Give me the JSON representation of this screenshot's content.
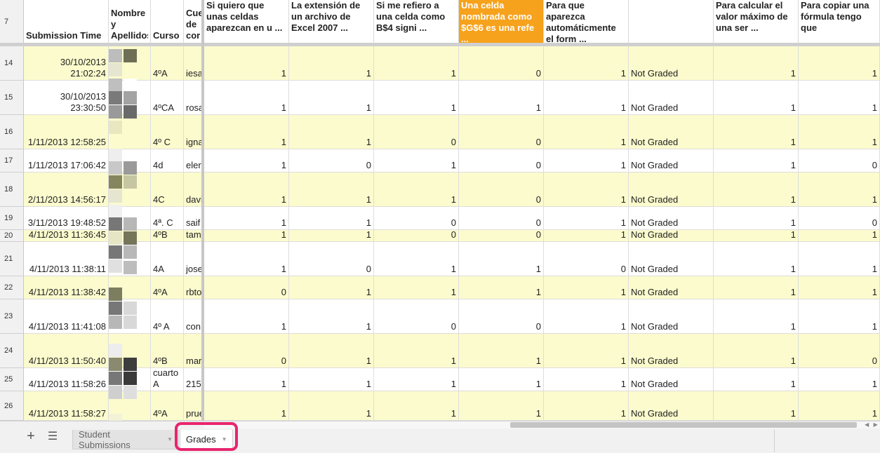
{
  "header": {
    "row_number": "7",
    "columns": [
      "Submission Time",
      "Nombre y Apellidos",
      "Curso",
      "Cue de cor",
      "Si quiero que unas celdas aparezcan en u ...",
      "La extensión de un archivo de Excel 2007 ...",
      "Si me refiero a una celda como B$4 signi ...",
      "Una celda nombrada como $G$6 es una refe ...",
      "Para que aparezca automáticmente el form ...",
      "",
      "Para calcular el valor máximo de una ser ...",
      "Para copiar una fórmula tengo que"
    ]
  },
  "rows": [
    {
      "num": "14",
      "time": "30/10/2013 21:02:24",
      "curso": "4ºA",
      "cue": "iesa",
      "q1": "1",
      "q2": "1",
      "q3": "1",
      "q4": "0",
      "q5": "1",
      "status": "Not Graded",
      "q6": "1",
      "q7": "1"
    },
    {
      "num": "15",
      "time": "30/10/2013 23:30:50",
      "curso": "4ºCA",
      "cue": "rosa",
      "q1": "1",
      "q2": "1",
      "q3": "1",
      "q4": "1",
      "q5": "1",
      "status": "Not Graded",
      "q6": "1",
      "q7": "1"
    },
    {
      "num": "16",
      "time": "1/11/2013 12:58:25",
      "curso": "4º C",
      "cue": "igna",
      "q1": "1",
      "q2": "1",
      "q3": "0",
      "q4": "0",
      "q5": "1",
      "status": "Not Graded",
      "q6": "1",
      "q7": "1"
    },
    {
      "num": "17",
      "time": "1/11/2013 17:06:42",
      "curso": "4d",
      "cue": "eler",
      "q1": "1",
      "q2": "0",
      "q3": "1",
      "q4": "0",
      "q5": "1",
      "status": "Not Graded",
      "q6": "1",
      "q7": "0"
    },
    {
      "num": "18",
      "time": "2/11/2013 14:56:17",
      "curso": "4C",
      "cue": "davi",
      "q1": "1",
      "q2": "1",
      "q3": "1",
      "q4": "0",
      "q5": "1",
      "status": "Not Graded",
      "q6": "1",
      "q7": "1"
    },
    {
      "num": "19",
      "time": "3/11/2013 19:48:52",
      "curso": "4ª. C",
      "cue": "saif",
      "q1": "1",
      "q2": "1",
      "q3": "0",
      "q4": "0",
      "q5": "1",
      "status": "Not Graded",
      "q6": "1",
      "q7": "0"
    },
    {
      "num": "20",
      "time": "4/11/2013 11:36:45",
      "curso": "4ºB",
      "cue": "tam",
      "q1": "1",
      "q2": "1",
      "q3": "0",
      "q4": "0",
      "q5": "1",
      "status": "Not Graded",
      "q6": "1",
      "q7": "1"
    },
    {
      "num": "21",
      "time": "4/11/2013 11:38:11",
      "curso": "4A",
      "cue": "jose",
      "q1": "1",
      "q2": "0",
      "q3": "1",
      "q4": "1",
      "q5": "0",
      "status": "Not Graded",
      "q6": "1",
      "q7": "1"
    },
    {
      "num": "22",
      "time": "4/11/2013 11:38:42",
      "curso": "4ºA",
      "cue": "rbto",
      "q1": "0",
      "q2": "1",
      "q3": "1",
      "q4": "1",
      "q5": "1",
      "status": "Not Graded",
      "q6": "1",
      "q7": "1"
    },
    {
      "num": "23",
      "time": "4/11/2013 11:41:08",
      "curso": "4º A",
      "cue": "con",
      "q1": "1",
      "q2": "1",
      "q3": "0",
      "q4": "0",
      "q5": "1",
      "status": "Not Graded",
      "q6": "1",
      "q7": "1"
    },
    {
      "num": "24",
      "time": "4/11/2013 11:50:40",
      "curso": "4ºB",
      "cue": "mar",
      "q1": "0",
      "q2": "1",
      "q3": "1",
      "q4": "1",
      "q5": "1",
      "status": "Not Graded",
      "q6": "1",
      "q7": "0"
    },
    {
      "num": "25",
      "time": "4/11/2013 11:58:26",
      "curso": "cuarto A",
      "cue": "215",
      "q1": "1",
      "q2": "1",
      "q3": "1",
      "q4": "1",
      "q5": "1",
      "status": "Not Graded",
      "q6": "1",
      "q7": "1"
    },
    {
      "num": "26",
      "time": "4/11/2013 11:58:27",
      "curso": "4ºA",
      "cue": "prue",
      "q1": "1",
      "q2": "1",
      "q3": "1",
      "q4": "1",
      "q5": "1",
      "status": "Not Graded",
      "q6": "1",
      "q7": "1"
    }
  ],
  "bottom": {
    "add_sheet_icon": "plus-icon",
    "sheet_list_icon": "menu-icon",
    "tabs": [
      {
        "label": "Student Submissions",
        "active": false
      },
      {
        "label": "Grades",
        "active": true
      }
    ]
  },
  "colors": {
    "row_highlight": "#fbfbcd",
    "selected_header": "#f6a21c",
    "annotation_ring": "#e8256e"
  }
}
